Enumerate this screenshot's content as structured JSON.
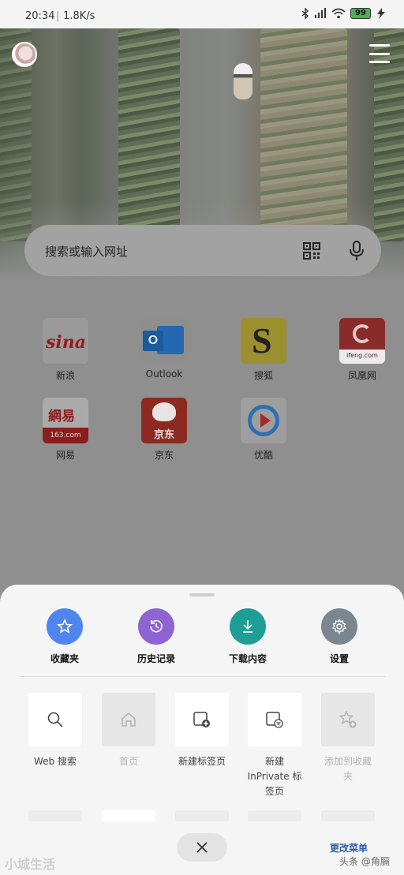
{
  "status_bar": {
    "time": "20:34",
    "separator": "|",
    "speed": "1.8K/s",
    "battery": "99",
    "icons": [
      "bluetooth-icon",
      "signal-icon",
      "wifi-icon",
      "battery-icon",
      "charging-icon"
    ]
  },
  "search": {
    "placeholder": "搜索或输入网址",
    "icons": [
      "qr-scan-icon",
      "microphone-icon"
    ]
  },
  "shortcuts": [
    {
      "label": "新浪",
      "logo_text": "sina"
    },
    {
      "label": "Outlook",
      "logo_text": "O"
    },
    {
      "label": "搜狐",
      "logo_text": "S"
    },
    {
      "label": "凤凰网",
      "logo_text": "ifeng.com"
    },
    {
      "label": "网易",
      "logo_text": "網易",
      "logo_sub": "163.com"
    },
    {
      "label": "京东",
      "logo_text": "京东"
    },
    {
      "label": "优酷"
    }
  ],
  "quick_actions": [
    {
      "label": "收藏夹",
      "icon": "star-icon",
      "color": "#4d86f0"
    },
    {
      "label": "历史记录",
      "icon": "history-icon",
      "color": "#8e63d2"
    },
    {
      "label": "下载内容",
      "icon": "download-icon",
      "color": "#1f9e95"
    },
    {
      "label": "设置",
      "icon": "gear-icon",
      "color": "#7b8790"
    }
  ],
  "tools": [
    {
      "label": "Web 搜索",
      "icon": "search-icon",
      "enabled": true
    },
    {
      "label": "首页",
      "icon": "home-icon",
      "enabled": false
    },
    {
      "label": "新建标签页",
      "icon": "new-tab-icon",
      "enabled": true
    },
    {
      "label_line1": "新建",
      "label_line2": "InPrivate 标",
      "label_line3": "签页",
      "icon": "inprivate-tab-icon",
      "enabled": true
    },
    {
      "label_line1": "添加到收藏",
      "label_line2": "夹",
      "icon": "add-favorite-icon",
      "enabled": false
    }
  ],
  "footer": {
    "edit_menu": "更改菜单",
    "close_icon": "close-icon",
    "watermark_left": "小城生活",
    "watermark_right": "头条 @角膈"
  }
}
